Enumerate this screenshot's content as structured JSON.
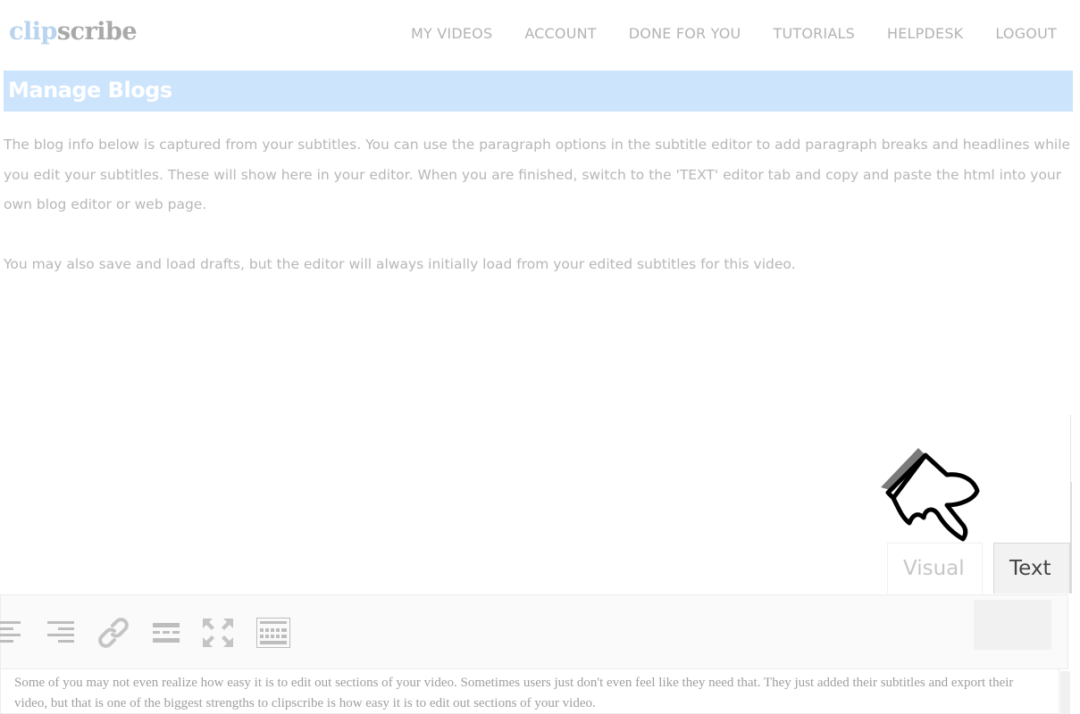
{
  "brand": {
    "part1": "clip",
    "part2": "scribe"
  },
  "nav": [
    "MY VIDEOS",
    "ACCOUNT",
    "DONE FOR YOU",
    "TUTORIALS",
    "HELPDESK",
    "LOGOUT"
  ],
  "page_title": "Manage Blogs",
  "intro": {
    "p1": "The blog info below is captured from your subtitles. You can use the paragraph options in the subtitle editor to add paragraph breaks and headlines while you edit your subtitles. These will show here in your editor. When you are finished, switch to the 'TEXT' editor tab and copy and paste the html into your own blog editor or web page.",
    "p2": "You may also save and load drafts, but the editor will always initially load from your edited subtitles for this video."
  },
  "editor": {
    "tabs": {
      "visual": "Visual",
      "text": "Text"
    },
    "toolbar_icons": [
      "align-center-icon",
      "align-right-icon",
      "link-icon",
      "read-more-icon",
      "fullscreen-icon",
      "toolbar-toggle-icon"
    ],
    "content": "Some of you may not even realize how easy it is to edit out sections of your video. Sometimes users just don't even feel like they need that. They just added their subtitles and export their video, but that is one of the biggest strengths to clipscribe is how easy it is to edit out sections of your video."
  },
  "colors": {
    "banner": "#cce4fc",
    "brand_clip": "#b8d4ee",
    "brand_scribe": "#a9a9a9"
  }
}
